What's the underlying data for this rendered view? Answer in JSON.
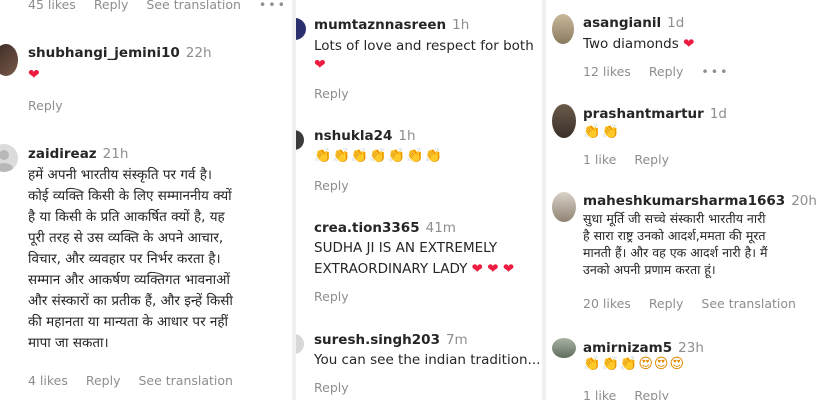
{
  "col1": {
    "top_meta": {
      "likes": "45 likes",
      "reply": "Reply",
      "translate": "See translation",
      "more": "•••"
    },
    "c1": {
      "username": "shubhangi_jemini10",
      "time": "22h",
      "reply": "Reply"
    },
    "c2": {
      "username": "zaidireaz",
      "time": "21h",
      "lines": [
        "हमें अपनी भारतीय संस्कृति पर गर्व है।",
        "कोई व्यक्ति किसी के लिए सम्माननीय क्यों",
        "है या किसी के प्रति आकर्षित क्यों है, यह",
        "पूरी तरह से उस व्यक्ति के अपने आचार,",
        "विचार, और व्यवहार पर निर्भर करता है।",
        "सम्मान और आकर्षण व्यक्तिगत भावनाओं",
        "और संस्कारों का प्रतीक हैं, और इन्हें किसी",
        "की महानता या मान्यता के आधार पर नहीं",
        "मापा जा सकता।"
      ],
      "likes": "4 likes",
      "reply": "Reply",
      "translate": "See translation"
    }
  },
  "col2": {
    "c1": {
      "username": "mumtaznnasreen",
      "time": "1h",
      "text": "Lots of love and respect for both",
      "reply": "Reply"
    },
    "c2": {
      "username": "nshukla24",
      "time": "1h",
      "reply": "Reply"
    },
    "c3": {
      "username": "crea.tion3365",
      "time": "41m",
      "line1": "SUDHA JI IS AN EXTREMELY",
      "line2": "EXTRAORDINARY LADY",
      "reply": "Reply"
    },
    "c4": {
      "username": "suresh.singh203",
      "time": "7m",
      "text": "You can see the indian tradition...",
      "reply": "Reply"
    }
  },
  "col3": {
    "c1": {
      "username": "asangianil",
      "time": "1d",
      "text": "Two diamonds",
      "likes": "12 likes",
      "reply": "Reply",
      "more": "•••"
    },
    "c2": {
      "username": "prashantmartur",
      "time": "1d",
      "likes": "1 like",
      "reply": "Reply"
    },
    "c3": {
      "username": "maheshkumarsharma1663",
      "time": "20h",
      "lines": [
        "सुधा मूर्ति जी सच्चे संस्कारी भारतीय नारी",
        "है सारा राष्ट्र उनको आदर्श,ममता की मूरत",
        "मानती हैं। और वह एक आदर्श नारी है। मैं",
        "उनको अपनी प्रणाम करता हूं।"
      ],
      "likes": "20 likes",
      "reply": "Reply",
      "translate": "See translation"
    },
    "c4": {
      "username": "amirnizam5",
      "time": "23h",
      "likes": "1 like",
      "reply": "Reply"
    }
  },
  "emoji": {
    "heart": "❤",
    "clap": "👏",
    "star_eyes": "😍"
  },
  "colors": {
    "heart": "#ed1c40",
    "meta": "#8e8e8e",
    "text": "#262626"
  }
}
